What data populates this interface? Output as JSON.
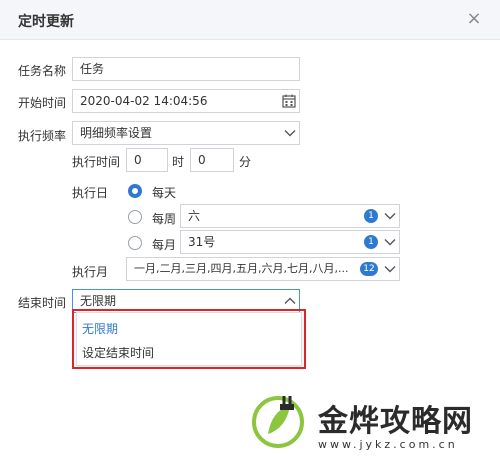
{
  "dialog": {
    "title": "定时更新",
    "close_glyph": "×"
  },
  "form": {
    "task_name_label": "任务名称",
    "task_name_value": "任务",
    "start_time_label": "开始时间",
    "start_time_value": "2020-04-02 14:04:56",
    "frequency_label": "执行频率",
    "frequency_value": "明细频率设置",
    "exec_time_label": "执行时间",
    "exec_hour_value": "0",
    "hour_unit": "时",
    "exec_minute_value": "0",
    "minute_unit": "分",
    "exec_day_label": "执行日",
    "daily_label": "每天",
    "weekly_label": "每周",
    "weekly_value": "六",
    "weekly_count": "1",
    "monthly_label": "每月",
    "monthly_value": "31号",
    "monthly_count": "1",
    "exec_month_label": "执行月",
    "exec_month_value": "一月,二月,三月,四月,五月,六月,七月,八月,...",
    "exec_month_count": "12",
    "end_time_label": "结束时间",
    "end_time_value": "无限期"
  },
  "dropdown_options": [
    "无限期",
    "设定结束时间"
  ],
  "watermark": {
    "brand": "金烨攻略网",
    "url": "www.jykz.com.cn"
  },
  "colors": {
    "accent": "#2f7ad1",
    "highlight_border": "#d9262c",
    "header_bg": "#f4f6f9",
    "logo_green": "#8cc63f"
  },
  "icons": {
    "close": "close-icon",
    "calendar": "calendar-icon",
    "chevron": "chevron-down-icon",
    "chevron_up": "chevron-up-icon"
  }
}
